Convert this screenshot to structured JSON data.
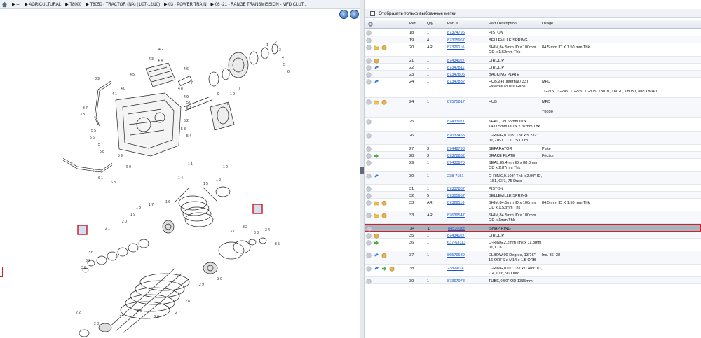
{
  "breadcrumb": {
    "items": [
      "---",
      "AGRICULTURAL",
      "T8000",
      "T8050 - TRACTOR (NA) (1/07-12/10)",
      "03 - POWER TRAIN",
      "06 -21 - RANGE TRANSMISSION - MFD CLUT..."
    ]
  },
  "nav": {
    "back": "‹",
    "forward": "›"
  },
  "filter": {
    "label": "Отобразить только выбранные метки"
  },
  "table": {
    "headers": {
      "ref": "Ref",
      "qty": "Qty",
      "part": "Part #",
      "desc": "Part Description",
      "usage": "Usage"
    },
    "rows": [
      {
        "ref": "18",
        "qty": "1",
        "part": "87374796",
        "desc": "PISTON",
        "usage": "",
        "icons": [
          "circle"
        ]
      },
      {
        "ref": "19",
        "qty": "4",
        "part": "87305967",
        "desc": "BELLEVILLE SPRING",
        "usage": "",
        "icons": [
          "circle"
        ]
      },
      {
        "ref": "20",
        "qty": "AR",
        "part": "87329116",
        "desc": "SHIM,84.5mm ID x 100mm OD x 1.52mm Thk",
        "usage": "84.5 mm ID X 1.50 mm Thk",
        "icons": [
          "circle",
          "folder",
          "box"
        ]
      },
      {
        "ref": "21",
        "qty": "1",
        "part": "87434027",
        "desc": "CIRCLIP",
        "usage": "",
        "icons": [
          "circle",
          "box"
        ]
      },
      {
        "ref": "22",
        "qty": "1",
        "part": "87347811",
        "desc": "CIRCLIP",
        "usage": "",
        "icons": [
          "circle",
          "redo"
        ]
      },
      {
        "ref": "23",
        "qty": "1",
        "part": "87347805",
        "desc": "BACKING PLATE",
        "usage": "",
        "icons": [
          "circle"
        ]
      },
      {
        "ref": "24",
        "qty": "1",
        "part": "87347832",
        "desc": "HUB,24T Internal / 33T External Plus 6 Gaps",
        "usage": "MFD\n\nTG215, TG245, TG275, TG305, T8010, T8020, T8030, and T8040",
        "icons": [
          "circle",
          "redo"
        ]
      },
      {
        "ref": "24",
        "qty": "1",
        "part": "87575817",
        "desc": "HUB",
        "usage": "MFD\n\nT8050",
        "icons": [
          "circle",
          "folder",
          "box"
        ]
      },
      {
        "ref": "25",
        "qty": "1",
        "part": "87433971",
        "desc": "SEAL,139.65mm ID x 143.05mm OD x 2.87mm Thk",
        "usage": "",
        "icons": [
          "circle"
        ]
      },
      {
        "ref": "26",
        "qty": "1",
        "part": "87037455",
        "desc": "O-RING,0.103\" Thk x 5.237\" ID, -160, Cl 7, 75 Duro",
        "usage": "",
        "icons": [
          "circle"
        ]
      },
      {
        "ref": "27",
        "qty": "3",
        "part": "87449793",
        "desc": "SEPARATOR",
        "usage": "Plate",
        "icons": [
          "circle"
        ]
      },
      {
        "ref": "28",
        "qty": "3",
        "part": "87378862",
        "desc": "BRAKE PLATE",
        "usage": "Friction",
        "icons": [
          "circle",
          "arrow"
        ]
      },
      {
        "ref": "29",
        "qty": "1",
        "part": "87433970",
        "desc": "SEAL,85.4mm ID x 88.8mm OD x 2.87mm Thk",
        "usage": "",
        "icons": [
          "circle"
        ]
      },
      {
        "ref": "30",
        "qty": "1",
        "part": "238-7151",
        "desc": "O-RING,0.103\" Thk x 2.99\" ID, -151, Cl 7, 75 Duro",
        "usage": "",
        "icons": [
          "circle",
          "redo"
        ]
      },
      {
        "ref": "31",
        "qty": "1",
        "part": "87337887",
        "desc": "PISTON",
        "usage": "",
        "icons": [
          "circle"
        ]
      },
      {
        "ref": "32",
        "qty": "5",
        "part": "87305967",
        "desc": "BELLEVILLE SPRING",
        "usage": "",
        "icons": [
          "circle"
        ]
      },
      {
        "ref": "33",
        "qty": "AR",
        "part": "87329116",
        "desc": "SHIM,84.5mm ID x 100mm OD x 1.52mm Thk",
        "usage": "84.5 mm ID X 1.50 mm Thk",
        "icons": [
          "circle",
          "folder",
          "box"
        ]
      },
      {
        "ref": "33",
        "qty": "AR",
        "part": "87639547",
        "desc": "SHIM,84.5mm ID x 100mm OD x 1mm Thk",
        "usage": "",
        "icons": [
          "circle",
          "folder",
          "box"
        ]
      },
      {
        "ref": "34",
        "qty": "1",
        "part": "84530165",
        "desc": "SNAP RING",
        "usage": "",
        "icons": [
          "circle"
        ],
        "selected": true
      },
      {
        "ref": "35",
        "qty": "1",
        "part": "87434027",
        "desc": "CIRCLIP",
        "usage": "",
        "icons": [
          "circle",
          "box"
        ]
      },
      {
        "ref": "36",
        "qty": "1",
        "part": "637-63113",
        "desc": "O-RING,2.2mm Thk x 11.3mm ID, Cl 6",
        "usage": "",
        "icons": [
          "circle",
          "arrow"
        ]
      },
      {
        "ref": "37",
        "qty": "1",
        "part": "86579689",
        "desc": "ELBOW,90 Degree, 13/16\" - 16 ORFS x M14 x 1.5 ORB",
        "usage": "Inc. 36, 38",
        "icons": [
          "circle",
          "redo",
          "box"
        ]
      },
      {
        "ref": "38",
        "qty": "1",
        "part": "238-6014",
        "desc": "O-RING,0.07\" Thk x 0.489\" ID, -14, Cl 6, 90 Duro",
        "usage": "",
        "icons": [
          "circle",
          "redo",
          "arrow",
          "box"
        ]
      },
      {
        "ref": "39",
        "qty": "1",
        "part": "87367978",
        "desc": "TUBE,0.50\" OD 1335mm",
        "usage": "",
        "icons": [
          "circle"
        ]
      }
    ]
  },
  "diagram": {
    "callouts": [
      "42",
      "43",
      "44",
      "45",
      "46",
      "47",
      "48",
      "39",
      "37",
      "38",
      "40",
      "41",
      "49",
      "50",
      "51",
      "52",
      "53",
      "54",
      "55",
      "56",
      "57",
      "58",
      "59",
      "60",
      "61",
      "62",
      "63",
      "1",
      "2",
      "3",
      "4",
      "5",
      "6",
      "7",
      "8",
      "9",
      "10",
      "11",
      "12",
      "13",
      "14",
      "15",
      "16",
      "17",
      "18",
      "19",
      "20",
      "21",
      "22",
      "23",
      "24",
      "25",
      "26",
      "27",
      "28",
      "29",
      "30",
      "31",
      "32",
      "33",
      "34",
      "35",
      "36"
    ]
  },
  "colors": {
    "link": "#1a56c4",
    "selection": "#a9b4c1",
    "highlight": "#d0202a"
  }
}
